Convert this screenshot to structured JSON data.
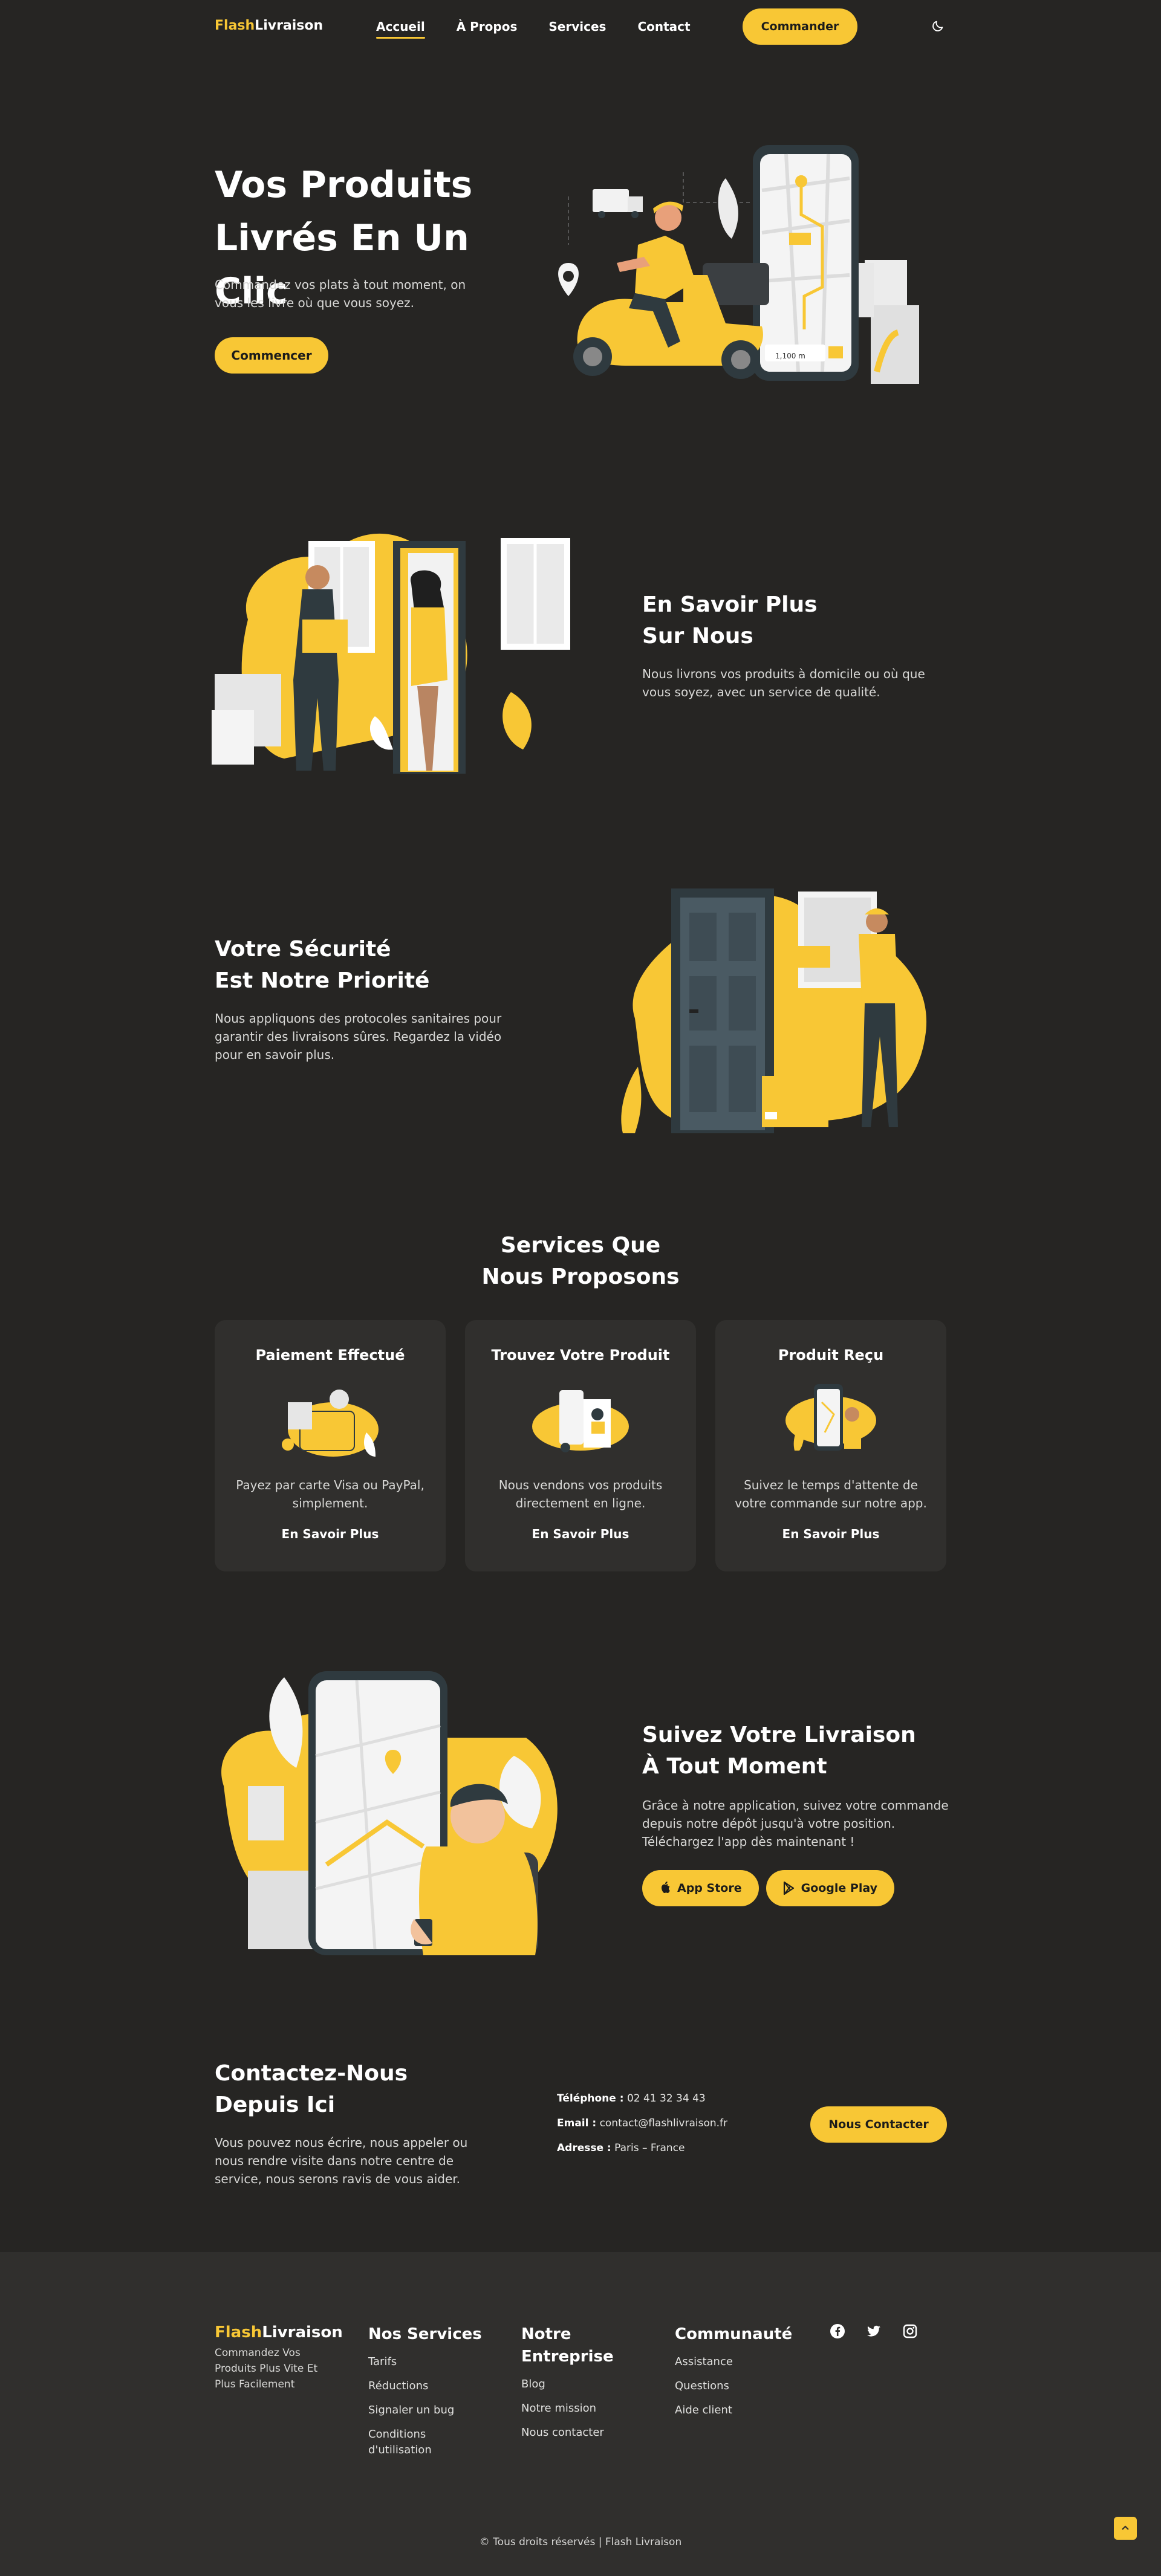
{
  "nav": {
    "logo_a": "Flash",
    "logo_b": "Livraison",
    "links": [
      "Accueil",
      "À Propos",
      "Services",
      "Contact"
    ],
    "order_button": "Commander",
    "theme_icon": "moon-icon"
  },
  "hero": {
    "title_line1": "Vos Produits",
    "title_line2": "Livrés En Un Clic",
    "desc": "Commandez vos plats à tout moment, on vous les livre où que vous soyez.",
    "button": "Commencer",
    "map_distance": "1,100 m"
  },
  "about": {
    "title_line1": "En Savoir Plus",
    "title_line2": "Sur Nous",
    "desc": "Nous livrons vos produits à domicile ou où que vous soyez, avec un service de qualité."
  },
  "security": {
    "title_line1": "Votre Sécurité",
    "title_line2": "Est Notre Priorité",
    "desc": "Nous appliquons des protocoles sanitaires pour garantir des livraisons sûres. Regardez la vidéo pour en savoir plus."
  },
  "services": {
    "title_line1": "Services Que",
    "title_line2": "Nous Proposons",
    "cards": [
      {
        "title": "Paiement Effectué",
        "desc": "Payez par carte Visa ou PayPal, simplement.",
        "link": "En Savoir Plus"
      },
      {
        "title": "Trouvez Votre Produit",
        "desc": "Nous vendons vos produits directement en ligne.",
        "link": "En Savoir Plus"
      },
      {
        "title": "Produit Reçu",
        "desc": "Suivez le temps d'attente de votre commande sur notre app.",
        "link": "En Savoir Plus"
      }
    ]
  },
  "tracking": {
    "title_line1": "Suivez Votre Livraison",
    "title_line2": "À Tout Moment",
    "desc": "Grâce à notre application, suivez votre commande depuis notre dépôt jusqu'à votre position. Téléchargez l'app dès maintenant !",
    "app_store": "App Store",
    "google_play": "Google Play"
  },
  "contact": {
    "title_line1": "Contactez-Nous",
    "title_line2": "Depuis Ici",
    "desc": "Vous pouvez nous écrire, nous appeler ou nous rendre visite dans notre centre de service, nous serons ravis de vous aider.",
    "phone_label": "Téléphone :",
    "phone": "02 41 32 34 43",
    "email_label": "Email :",
    "email": "contact@flashlivraison.fr",
    "address_label": "Adresse :",
    "address": "Paris – France",
    "button": "Nous Contacter"
  },
  "footer": {
    "logo_a": "Flash",
    "logo_b": "Livraison",
    "tagline": "Commandez Vos Produits Plus Vite Et Plus Facilement",
    "col1": {
      "title": "Nos Services",
      "links": [
        "Tarifs",
        "Réductions",
        "Signaler un bug",
        "Conditions d'utilisation"
      ]
    },
    "col2": {
      "title_line1": "Notre",
      "title_line2": "Entreprise",
      "links": [
        "Blog",
        "Notre mission",
        "Nous contacter"
      ]
    },
    "col3": {
      "title": "Communauté",
      "links": [
        "Assistance",
        "Questions",
        "Aide client"
      ]
    },
    "socials": [
      "facebook-icon",
      "twitter-icon",
      "instagram-icon"
    ],
    "copyright": "© Tous droits réservés | Flash Livraison"
  },
  "colors": {
    "accent": "#f8c735",
    "background": "#262523",
    "card": "#302f2d"
  }
}
